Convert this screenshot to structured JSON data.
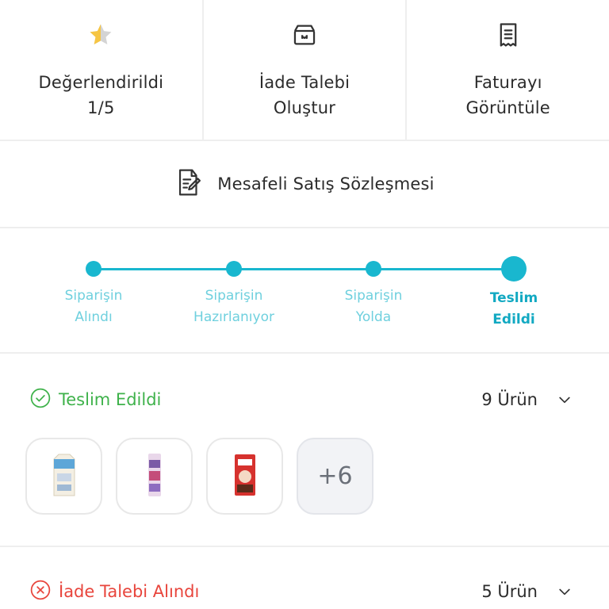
{
  "actions": [
    {
      "icon": "star-icon",
      "line1": "Değerlendirildi",
      "line2": "1/5"
    },
    {
      "icon": "return-box-icon",
      "line1": "İade Talebi",
      "line2": "Oluştur"
    },
    {
      "icon": "invoice-icon",
      "line1": "Faturayı",
      "line2": "Görüntüle"
    }
  ],
  "contract": {
    "icon": "document-edit-icon",
    "label": "Mesafeli Satış Sözleşmesi"
  },
  "tracker": {
    "accent": "#19b7cf",
    "steps": [
      {
        "line1": "Siparişin",
        "line2": "Alındı"
      },
      {
        "line1": "Siparişin",
        "line2": "Hazırlanıyor"
      },
      {
        "line1": "Siparişin",
        "line2": "Yolda"
      },
      {
        "line1": "Teslim",
        "line2": "Edildi"
      }
    ],
    "current_step": 4
  },
  "delivered": {
    "status_icon": "check-circle-icon",
    "status": "Teslim Edildi",
    "status_color": "#3fb24b",
    "count": "9 Ürün",
    "products": [
      "milk-carton-image",
      "snack-bar-image",
      "cereal-box-image"
    ],
    "more": "+6"
  },
  "returns": {
    "status_icon": "x-circle-icon",
    "status": "İade Talebi Alındı",
    "status_color": "#e8453c",
    "count": "5 Ürün"
  }
}
